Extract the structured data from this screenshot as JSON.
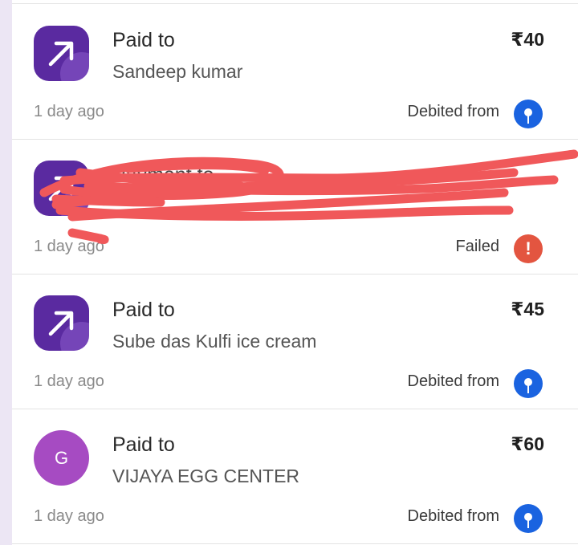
{
  "transactions": [
    {
      "title": "Paid to",
      "name": "Sandeep kumar",
      "amount": "₹40",
      "time": "1 day ago",
      "status": "Debited from",
      "avatar_type": "arrow-icon",
      "status_icon": "bank-icon"
    },
    {
      "title": "Payment to",
      "name": "",
      "amount": "",
      "time": "1 day ago",
      "status": "Failed",
      "avatar_type": "arrow-icon",
      "status_icon": "alert-icon",
      "fail_symbol": "!"
    },
    {
      "title": "Paid to",
      "name": "Sube das Kulfi ice cream",
      "amount": "₹45",
      "time": "1 day ago",
      "status": "Debited from",
      "avatar_type": "arrow-icon",
      "status_icon": "bank-icon"
    },
    {
      "title": "Paid to",
      "name": "VIJAYA EGG CENTER",
      "amount": "₹60",
      "time": "1 day ago",
      "status": "Debited from",
      "avatar_type": "letter",
      "avatar_letter": "G",
      "status_icon": "bank-icon"
    }
  ],
  "colors": {
    "avatar_purple": "#5a2aa0",
    "avatar_letter_bg": "#a64bc2",
    "bank_blue": "#1a63e0",
    "failed_red": "#e35540",
    "scribble": "#f0585a"
  }
}
